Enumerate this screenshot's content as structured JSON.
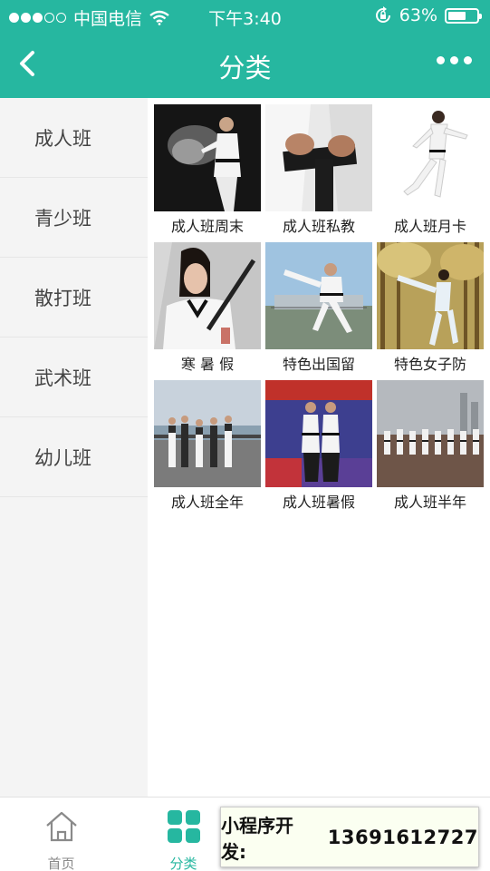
{
  "status": {
    "carrier": "中国电信",
    "time": "下午3:40",
    "battery": "63%",
    "battery_fraction": 0.63
  },
  "nav": {
    "title": "分类"
  },
  "sidebar": {
    "items": [
      {
        "label": "成人班"
      },
      {
        "label": "青少班"
      },
      {
        "label": "散打班"
      },
      {
        "label": "武术班"
      },
      {
        "label": "幼儿班"
      }
    ]
  },
  "products": [
    {
      "caption": "成人班周末",
      "photo": "woman-kick-dark"
    },
    {
      "caption": "成人班私教",
      "photo": "black-belt-closeup"
    },
    {
      "caption": "成人班月卡",
      "photo": "jump-kick-white"
    },
    {
      "caption": "寒 暑 假",
      "photo": "woman-nunchaku"
    },
    {
      "caption": "特色出国留",
      "photo": "flying-kick-outdoor"
    },
    {
      "caption": "特色女子防",
      "photo": "kick-forest"
    },
    {
      "caption": "成人班全年",
      "photo": "group-riverside"
    },
    {
      "caption": "成人班暑假",
      "photo": "two-fighters-stage"
    },
    {
      "caption": "成人班半年",
      "photo": "group-line-city"
    }
  ],
  "tabbar": {
    "tabs": [
      {
        "label": "首页",
        "icon": "home-icon",
        "active": false
      },
      {
        "label": "分类",
        "icon": "grid-icon",
        "active": true
      }
    ],
    "active_color": "#26b7a0",
    "inactive_color": "#8a8a8a"
  },
  "overlay": {
    "label": "小程序开发:",
    "phone": "13691612727"
  },
  "colors": {
    "accent": "#26b7a0"
  }
}
